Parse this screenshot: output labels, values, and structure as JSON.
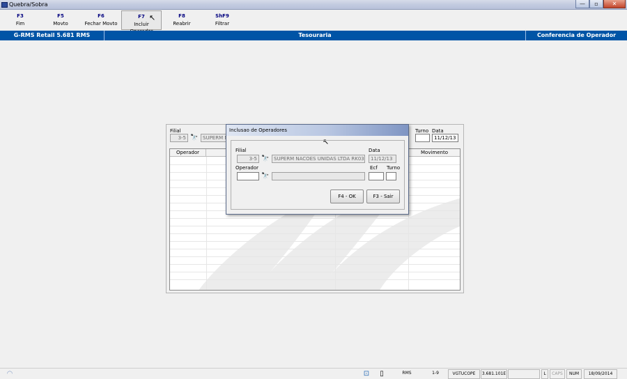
{
  "window": {
    "title": "Quebra/Sobra",
    "minimize": "—",
    "maximize": "▫",
    "close": "✕"
  },
  "toolbar": [
    {
      "key": "F3",
      "label": "Fim"
    },
    {
      "key": "F5",
      "label": "Movto"
    },
    {
      "key": "F6",
      "label": "Fechar Movto"
    },
    {
      "key": "F7",
      "label": "Incluir Operador"
    },
    {
      "key": "F8",
      "label": "Reabrir"
    },
    {
      "key": "ShF9",
      "label": "Filtrar"
    }
  ],
  "header": {
    "left": "G-RMS Retail 5.681 RMS",
    "center": "Tesouraria",
    "right": "Conferencia de Operador"
  },
  "form": {
    "filial_label": "Filial",
    "filial_value": "3-5",
    "filial_name": "SUPERM N",
    "turno_label": "Turno",
    "data_label": "Data",
    "turno_value": "",
    "data_value": "11/12/13",
    "grid_headers": [
      "Operador",
      "Movimento"
    ]
  },
  "dialog": {
    "title": "Inclusao de Operadores",
    "filial_label": "Filial",
    "filial_code": "3-5",
    "filial_name": "SUPERM NACOES UNIDAS LTDA RK03",
    "data_label": "Data",
    "data_value": "11/12/13",
    "operador_label": "Operador",
    "operador_value": "",
    "operador_name": "",
    "ecf_label": "Ecf",
    "turno_label": "Turno",
    "ecf_value": "",
    "turno_value": "",
    "ok_button": "F4 - OK",
    "exit_button": "F3 - Sair"
  },
  "statusbar": {
    "app": "RMS",
    "version_code": "1-9",
    "program": "VGTUCOPE",
    "build": "3.681.101E",
    "blank": "",
    "lock": "L",
    "caps": "CAPS",
    "num": "NUM",
    "date": "18/09/2014"
  }
}
